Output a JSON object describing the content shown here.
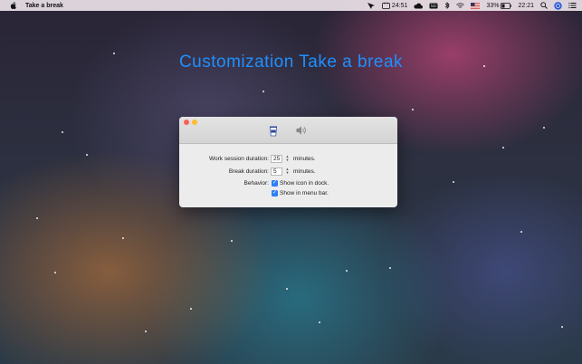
{
  "menubar": {
    "app_name": "Take a break",
    "timer": "24:51",
    "battery_percent": "33%",
    "clock": "22:21"
  },
  "headline": {
    "text_1": "Customization",
    "text_2": "Take a break"
  },
  "preferences": {
    "work_label": "Work session duration:",
    "work_value": "25",
    "work_unit": "minutes.",
    "break_label": "Break duration:",
    "break_value": "5",
    "break_unit": "minutes.",
    "behavior_label": "Behavior:",
    "show_dock_label": "Show icon in dock.",
    "show_dock_checked": true,
    "show_menubar_label": "Show in menu bar.",
    "show_menubar_checked": true
  },
  "colors": {
    "headline": "#1e90ff",
    "checkbox": "#2d7df6",
    "close": "#fc5f57",
    "minimize": "#fdbc2e"
  }
}
